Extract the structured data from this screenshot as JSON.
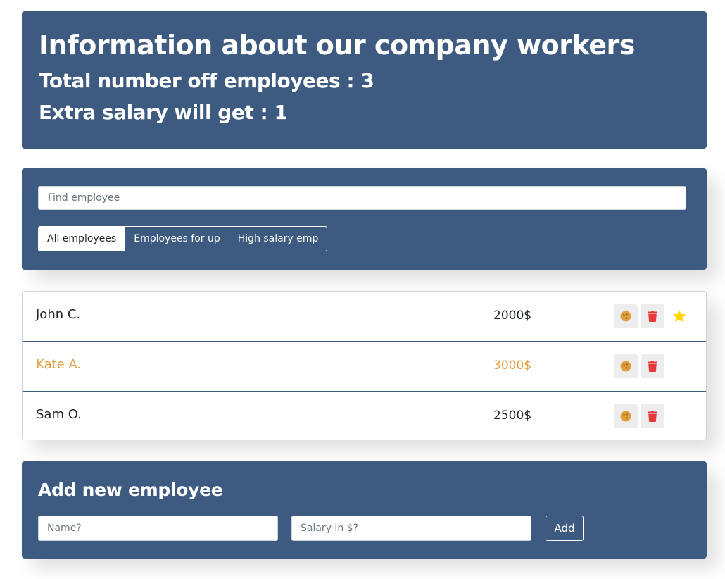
{
  "header": {
    "title": "Information about our company workers",
    "total_label": "Total number off employees : 3",
    "extra_label": "Extra salary will get : 1"
  },
  "search": {
    "placeholder": "Find employee"
  },
  "filters": [
    {
      "label": "All employees",
      "active": true
    },
    {
      "label": "Employees for up",
      "active": false
    },
    {
      "label": "High salary emp",
      "active": false
    }
  ],
  "employees": [
    {
      "name": "John C.",
      "salary": "2000$",
      "increase": false,
      "starred": true
    },
    {
      "name": "Kate A.",
      "salary": "3000$",
      "increase": true,
      "starred": false
    },
    {
      "name": "Sam O.",
      "salary": "2500$",
      "increase": false,
      "starred": false
    }
  ],
  "add_form": {
    "title": "Add new employee",
    "name_placeholder": "Name?",
    "salary_placeholder": "Salary in $?",
    "submit_label": "Add"
  },
  "colors": {
    "panel": "#3d5a80",
    "increase": "#e09f3e",
    "trash": "#e5383b",
    "star": "#ffd700"
  },
  "icons": {
    "cookie": "cookie-icon",
    "trash": "trash-icon",
    "star": "star-icon"
  }
}
